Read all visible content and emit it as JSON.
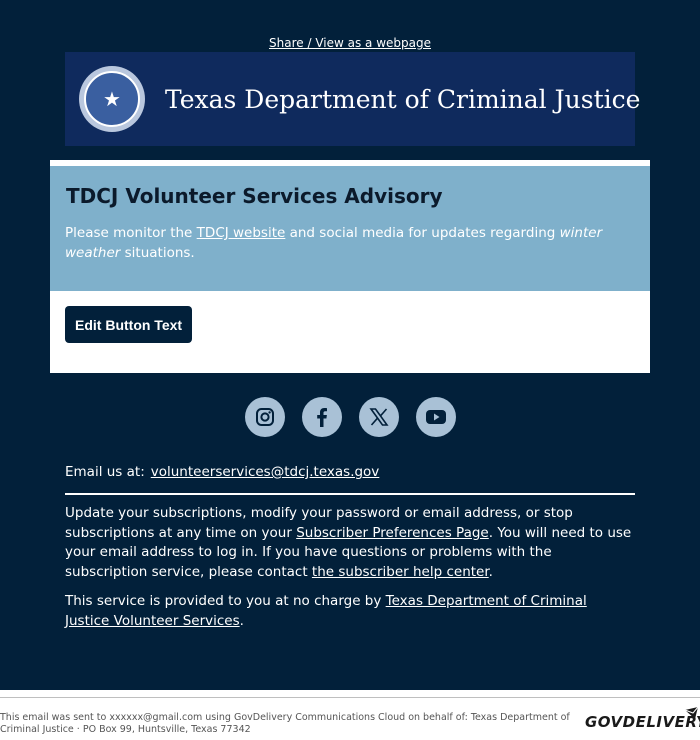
{
  "header": {
    "share_link": "Share / View as a webpage",
    "banner_title": "Texas Department of Criminal Justice",
    "seal_icon": "texas-seal-icon"
  },
  "advisory": {
    "title": "TDCJ Volunteer Services Advisory",
    "text_before": "Please monitor the ",
    "link": "TDCJ website",
    "text_middle": " and social media for updates regarding ",
    "emphasis": "winter weather",
    "text_after": " situations."
  },
  "button": {
    "label": "Edit Button Text"
  },
  "social": {
    "icons": [
      "instagram-icon",
      "facebook-icon",
      "x-icon",
      "youtube-icon"
    ]
  },
  "contact": {
    "label": "Email us at:",
    "email": "volunteerservices@tdcj.texas.gov"
  },
  "subscription": {
    "p1_a": "Update your subscriptions, modify your password or email address, or stop subscriptions at any time on your ",
    "p1_link1": "Subscriber Preferences Page",
    "p1_b": ". You will need to use your email address to log in. If you have questions or problems with the subscription service, please contact ",
    "p1_link2": "the subscriber help center",
    "p1_c": ".",
    "p2_a": "This service is provided to you at no charge by ",
    "p2_link": "Texas Department of Criminal Justice Volunteer Services",
    "p2_b": "."
  },
  "footer": {
    "text": "This email was sent to xxxxxx@gmail.com using GovDelivery Communications Cloud on behalf of: Texas Department of Criminal Justice · PO Box 99, Huntsville, Texas 77342",
    "logo": "GOVDELIVERY"
  },
  "colors": {
    "background": "#02203a",
    "banner": "#0f2a5d",
    "advisory": "#7fb0cb",
    "social_icon": "#a9c1d6"
  }
}
